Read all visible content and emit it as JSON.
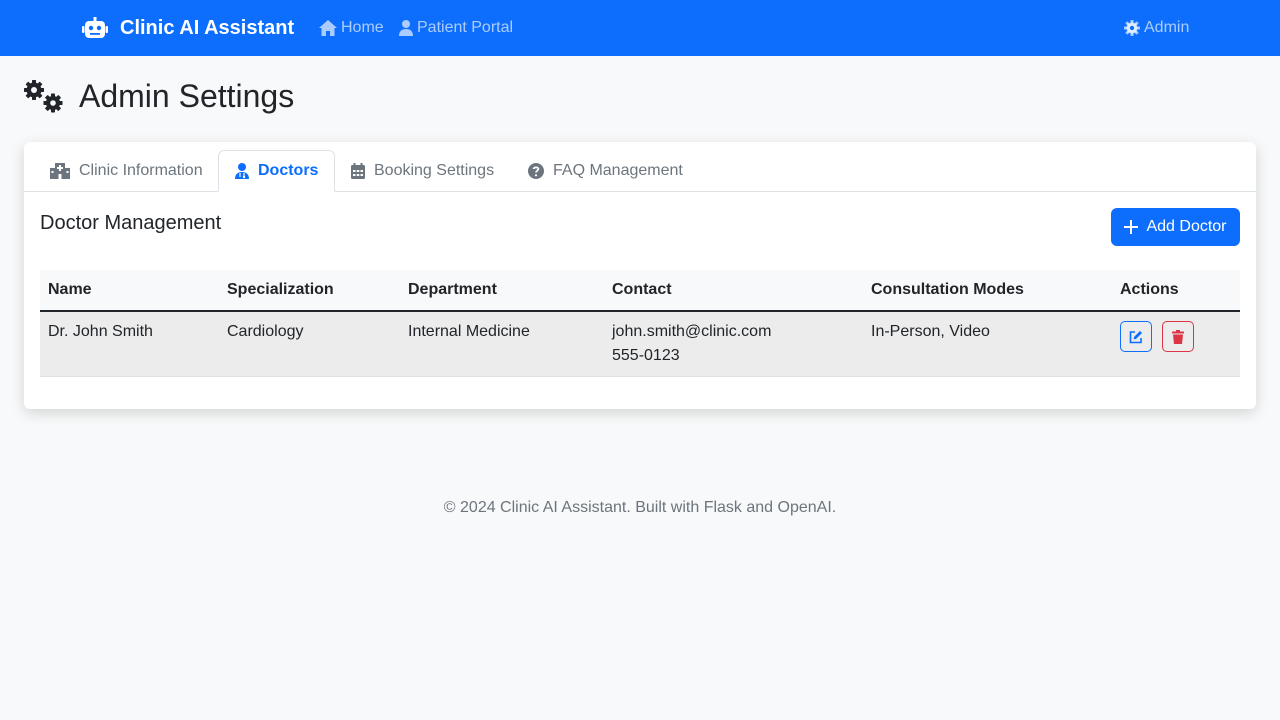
{
  "navbar": {
    "brand": "Clinic AI Assistant",
    "home": "Home",
    "patient_portal": "Patient Portal",
    "admin": "Admin"
  },
  "page": {
    "title": "Admin Settings"
  },
  "tabs": [
    {
      "label": "Clinic Information",
      "icon": "hospital-icon",
      "active": false
    },
    {
      "label": "Doctors",
      "icon": "user-doctor-icon",
      "active": true
    },
    {
      "label": "Booking Settings",
      "icon": "calendar-icon",
      "active": false
    },
    {
      "label": "FAQ Management",
      "icon": "question-circle-icon",
      "active": false
    }
  ],
  "doctors": {
    "title": "Doctor Management",
    "add_button": "Add Doctor",
    "columns": [
      "Name",
      "Specialization",
      "Department",
      "Contact",
      "Consultation Modes",
      "Actions"
    ],
    "rows": [
      {
        "name": "Dr. John Smith",
        "specialization": "Cardiology",
        "department": "Internal Medicine",
        "email": "john.smith@clinic.com",
        "phone": "555-0123",
        "modes": "In-Person, Video"
      }
    ]
  },
  "footer": {
    "text": "© 2024 Clinic AI Assistant. Built with Flask and OpenAI."
  },
  "colors": {
    "primary": "#0d6efd",
    "danger": "#dc3545",
    "muted": "#6c757d"
  }
}
